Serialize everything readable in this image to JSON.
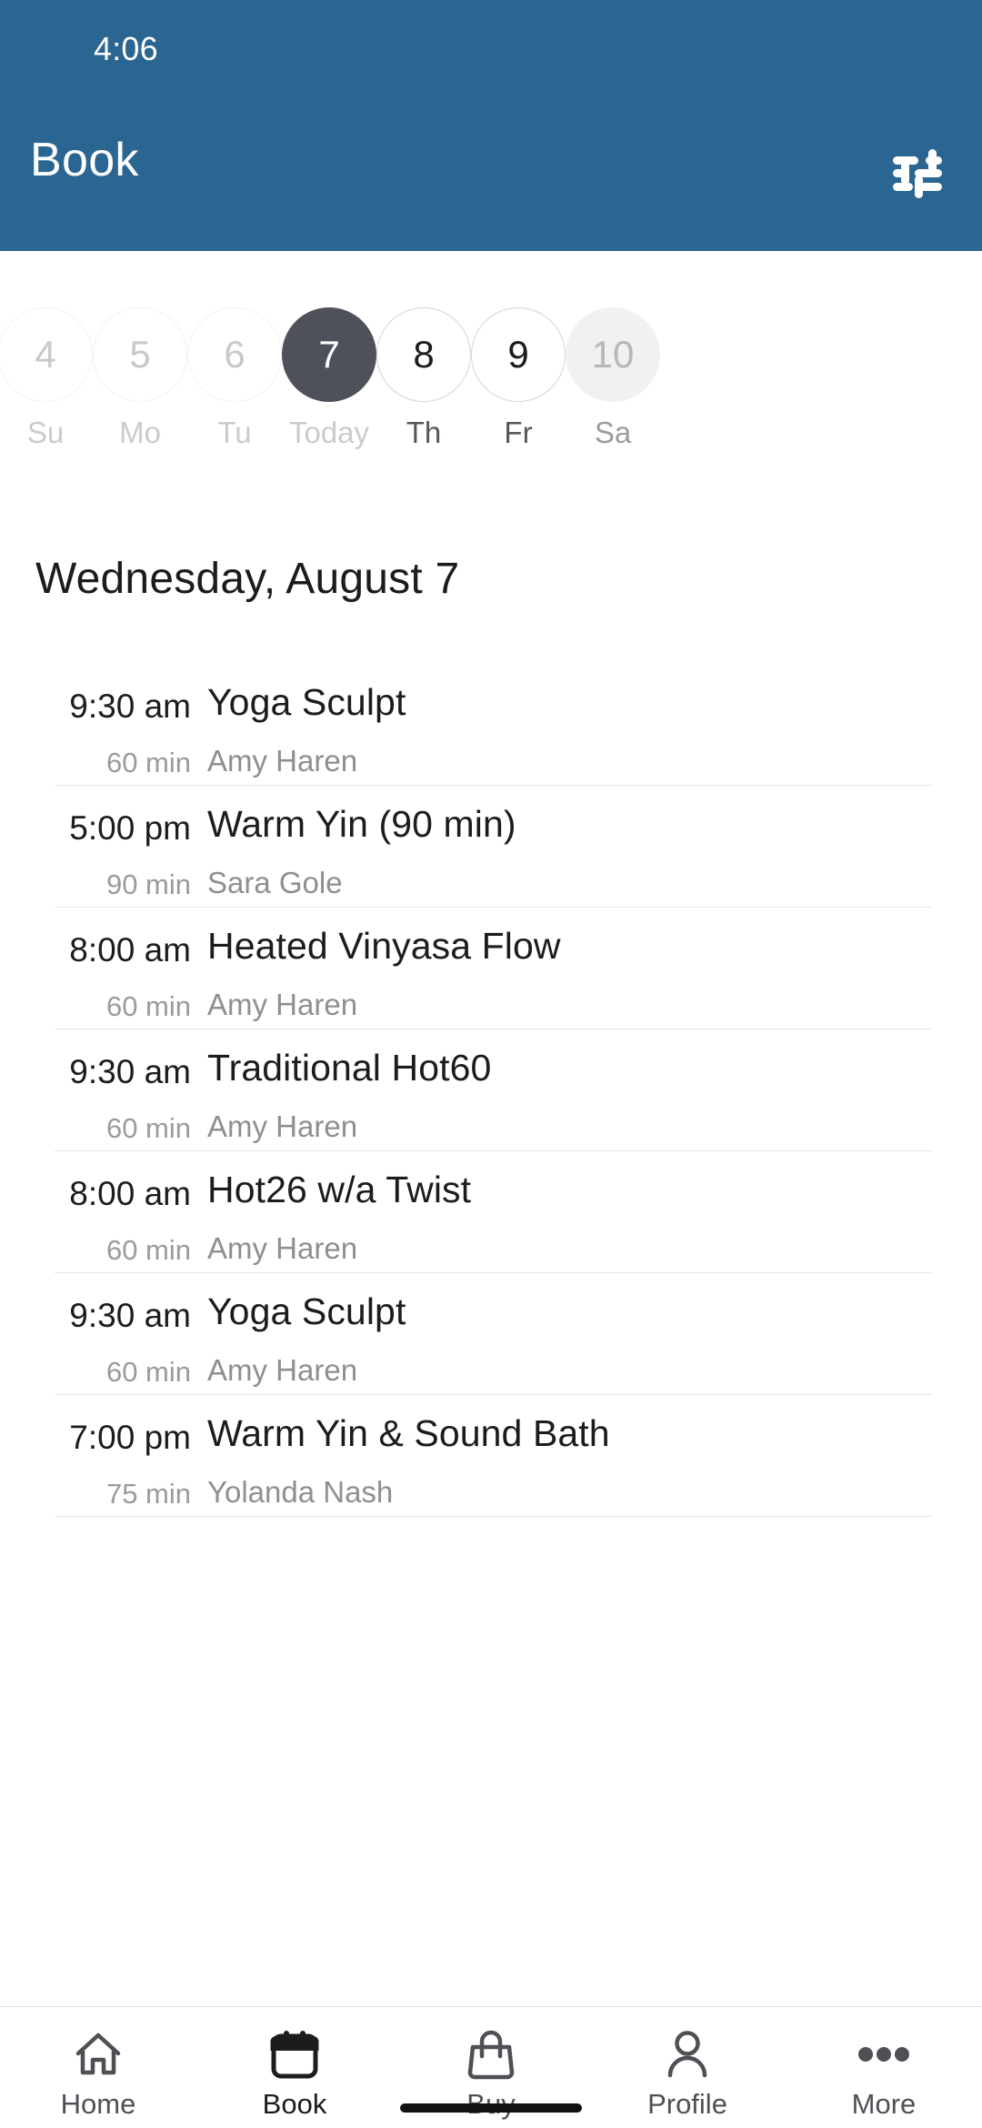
{
  "theme": {
    "header_blue": "#2a6691",
    "selected_day_bg": "#4e515a",
    "text_primary": "#1c1c1e",
    "text_muted": "#8e8f93",
    "divider": "#e6e6e8"
  },
  "status_bar": {
    "time": "4:06"
  },
  "app_bar": {
    "title": "Book",
    "filter_icon": "tune-filter-icon"
  },
  "date_strip": {
    "days": [
      {
        "num": "4",
        "label": "Su",
        "state": "past"
      },
      {
        "num": "5",
        "label": "Mo",
        "state": "past"
      },
      {
        "num": "6",
        "label": "Tu",
        "state": "past"
      },
      {
        "num": "7",
        "label": "Today",
        "state": "selected"
      },
      {
        "num": "8",
        "label": "Th",
        "state": "active"
      },
      {
        "num": "9",
        "label": "Fr",
        "state": "active"
      },
      {
        "num": "10",
        "label": "Sa",
        "state": "edge"
      }
    ]
  },
  "schedule": {
    "date_heading": "Wednesday, August 7",
    "classes": [
      {
        "time": "9:30 am",
        "duration": "60 min",
        "title": "Yoga Sculpt",
        "instructor": "Amy Haren"
      },
      {
        "time": "5:00 pm",
        "duration": "90 min",
        "title": "Warm Yin (90 min)",
        "instructor": "Sara Gole"
      },
      {
        "time": "8:00 am",
        "duration": "60 min",
        "title": "Heated Vinyasa Flow",
        "instructor": "Amy Haren"
      },
      {
        "time": "9:30 am",
        "duration": "60 min",
        "title": "Traditional Hot60",
        "instructor": "Amy Haren"
      },
      {
        "time": "8:00 am",
        "duration": "60 min",
        "title": "Hot26 w/a Twist",
        "instructor": "Amy Haren"
      },
      {
        "time": "9:30 am",
        "duration": "60 min",
        "title": "Yoga Sculpt",
        "instructor": "Amy Haren"
      },
      {
        "time": "7:00 pm",
        "duration": "75 min",
        "title": "Warm Yin & Sound Bath",
        "instructor": "Yolanda Nash"
      }
    ]
  },
  "bottom_nav": {
    "items": [
      {
        "label": "Home",
        "icon": "home-icon",
        "active": false
      },
      {
        "label": "Book",
        "icon": "calendar-icon",
        "active": true
      },
      {
        "label": "Buy",
        "icon": "bag-icon",
        "active": false
      },
      {
        "label": "Profile",
        "icon": "person-icon",
        "active": false
      },
      {
        "label": "More",
        "icon": "ellipsis-icon",
        "active": false
      }
    ]
  }
}
